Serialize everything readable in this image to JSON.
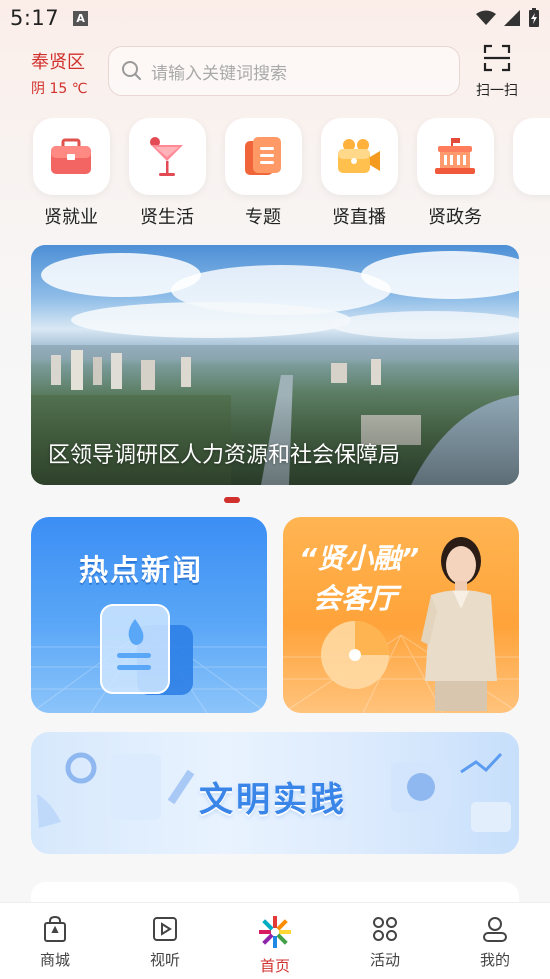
{
  "status_bar": {
    "time": "5:17",
    "notification_icon": "A"
  },
  "header": {
    "district": "奉贤区",
    "weather": "阴 15 ℃",
    "search_placeholder": "请输入关键词搜索",
    "scan_label": "扫一扫"
  },
  "shortcuts": [
    {
      "label": "贤就业",
      "icon": "briefcase-icon"
    },
    {
      "label": "贤生活",
      "icon": "cocktail-icon"
    },
    {
      "label": "专题",
      "icon": "document-icon"
    },
    {
      "label": "贤直播",
      "icon": "video-camera-icon"
    },
    {
      "label": "贤政务",
      "icon": "government-building-icon"
    }
  ],
  "banner": {
    "caption": "区领导调研区人力资源和社会保障局"
  },
  "cards": {
    "news_title": "热点新闻",
    "hall_title_line1": "“贤小融”",
    "hall_title_line2": "会客厅",
    "civ_title": "文明实践"
  },
  "tabbar": [
    {
      "label": "商城",
      "icon": "shopping-bag-icon",
      "active": false
    },
    {
      "label": "视听",
      "icon": "play-icon",
      "active": false
    },
    {
      "label": "首页",
      "icon": "home-logo-icon",
      "active": true
    },
    {
      "label": "活动",
      "icon": "grid-icon",
      "active": false
    },
    {
      "label": "我的",
      "icon": "user-icon",
      "active": false
    }
  ],
  "colors": {
    "accent": "#d0312d",
    "news_blue": "#3b8ef4",
    "hall_orange": "#ffa33a"
  }
}
